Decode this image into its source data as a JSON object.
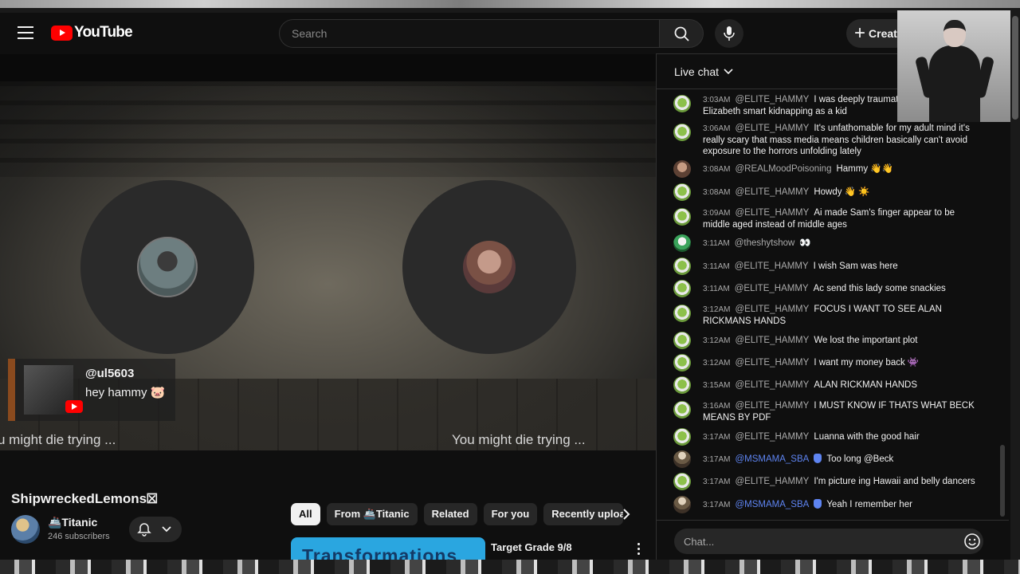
{
  "app": {
    "logo_text": "YouTube"
  },
  "header": {
    "search_placeholder": "Search",
    "create_label": "Create"
  },
  "video": {
    "overlay_comment": {
      "handle": "@ul5603",
      "message": "hey hammy 🐷"
    },
    "ticker_left": "u might die trying ...",
    "ticker_right": "You might die trying ..."
  },
  "below_video": {
    "title": "ShipwreckedLemons⮽",
    "channel_name": "🚢Titanic",
    "subscribers": "246 subscribers"
  },
  "chips": [
    {
      "label": "All",
      "active": true
    },
    {
      "label": "From 🚢Titanic"
    },
    {
      "label": "Related"
    },
    {
      "label": "For you"
    },
    {
      "label": "Recently uploaded"
    }
  ],
  "recommendation": {
    "thumb_text": "Transformations",
    "title": "Target Grade 9/8"
  },
  "chat": {
    "header_title": "Live chat",
    "input_placeholder": "Chat...",
    "messages": [
      {
        "time": "3:03AM",
        "author": "@ELITE_HAMMY",
        "text": "I was deeply traumatized by the Elizabeth smart kidnapping as a kid",
        "avatar": "a"
      },
      {
        "time": "3:06AM",
        "author": "@ELITE_HAMMY",
        "text": "It's unfathomable for my adult mind it's really scary that mass media means children basically can't avoid exposure to the horrors unfolding lately",
        "avatar": "a"
      },
      {
        "time": "3:08AM",
        "author": "@REALMoodPoisoning",
        "text": "Hammy 👋👋",
        "avatar": "b"
      },
      {
        "time": "3:08AM",
        "author": "@ELITE_HAMMY",
        "text": "Howdy 👋 ☀️",
        "avatar": "a"
      },
      {
        "time": "3:09AM",
        "author": "@ELITE_HAMMY",
        "text": "Ai made Sam's finger appear to be middle aged instead of middle ages",
        "avatar": "a"
      },
      {
        "time": "3:11AM",
        "author": "@theshytshow",
        "text": "👀",
        "avatar": "c"
      },
      {
        "time": "3:11AM",
        "author": "@ELITE_HAMMY",
        "text": "I wish Sam was here",
        "avatar": "a"
      },
      {
        "time": "3:11AM",
        "author": "@ELITE_HAMMY",
        "text": "Ac send this lady some snackies",
        "avatar": "a"
      },
      {
        "time": "3:12AM",
        "author": "@ELITE_HAMMY",
        "text": "FOCUS I WANT TO SEE ALAN RICKMANS HANDS",
        "avatar": "a"
      },
      {
        "time": "3:12AM",
        "author": "@ELITE_HAMMY",
        "text": "We lost the important plot",
        "avatar": "a"
      },
      {
        "time": "3:12AM",
        "author": "@ELITE_HAMMY",
        "text": "I want my money back 👾",
        "avatar": "a"
      },
      {
        "time": "3:15AM",
        "author": "@ELITE_HAMMY",
        "text": "ALAN RICKMAN HANDS",
        "avatar": "a"
      },
      {
        "time": "3:16AM",
        "author": "@ELITE_HAMMY",
        "text": "I MUST KNOW IF THATS WHAT BECK MEANS BY PDF",
        "avatar": "a"
      },
      {
        "time": "3:17AM",
        "author": "@ELITE_HAMMY",
        "text": "Luanna with the good hair",
        "avatar": "a"
      },
      {
        "time": "3:17AM",
        "author": "@MSMAMA_SBA",
        "text": "Too long @Beck",
        "avatar": "d",
        "moderator": true
      },
      {
        "time": "3:17AM",
        "author": "@ELITE_HAMMY",
        "text": "I'm picture ing Hawaii and belly dancers",
        "avatar": "a"
      },
      {
        "time": "3:17AM",
        "author": "@MSMAMA_SBA",
        "text": "Yeah I remember her",
        "avatar": "d",
        "moderator": true
      }
    ]
  },
  "colors": {
    "brand": "#ff0000",
    "moderator": "#5e84f1",
    "background": "#0f0f0f"
  }
}
